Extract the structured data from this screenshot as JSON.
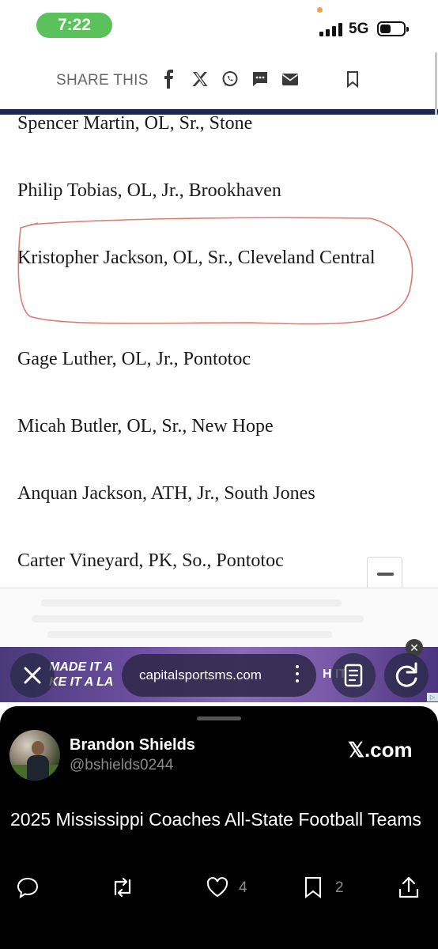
{
  "status": {
    "time": "7:22",
    "network": "5G"
  },
  "share_bar": {
    "label": "SHARE THIS"
  },
  "entries": [
    "Spencer Martin, OL, Sr., Stone",
    "Philip Tobias, OL, Jr., Brookhaven",
    "Kristopher Jackson, OL, Sr., Cleveland Central",
    "Gage Luther, OL, Jr., Pontotoc",
    "Micah Butler, OL, Sr., New Hope",
    "Anquan Jackson, ATH, Jr., South Jones",
    "Carter Vineyard, PK, So., Pontotoc"
  ],
  "ad": {
    "line1": "MADE IT A",
    "line2": "KE IT A LA",
    "right": "H    IT",
    "close": "✕",
    "badge": "▷"
  },
  "browser": {
    "url": "capitalsportsms.com"
  },
  "tweet": {
    "author_name": "Brandon Shields",
    "author_handle": "@bshields0244",
    "source": "𝕏.com",
    "text": "2025 Mississippi Coaches All-State Football Teams",
    "likes": "4",
    "bookmarks": "2"
  },
  "colors": {
    "nav_line": "#1d2850",
    "time_pill": "#5bc25b",
    "circle_mark": "#e07a70"
  }
}
